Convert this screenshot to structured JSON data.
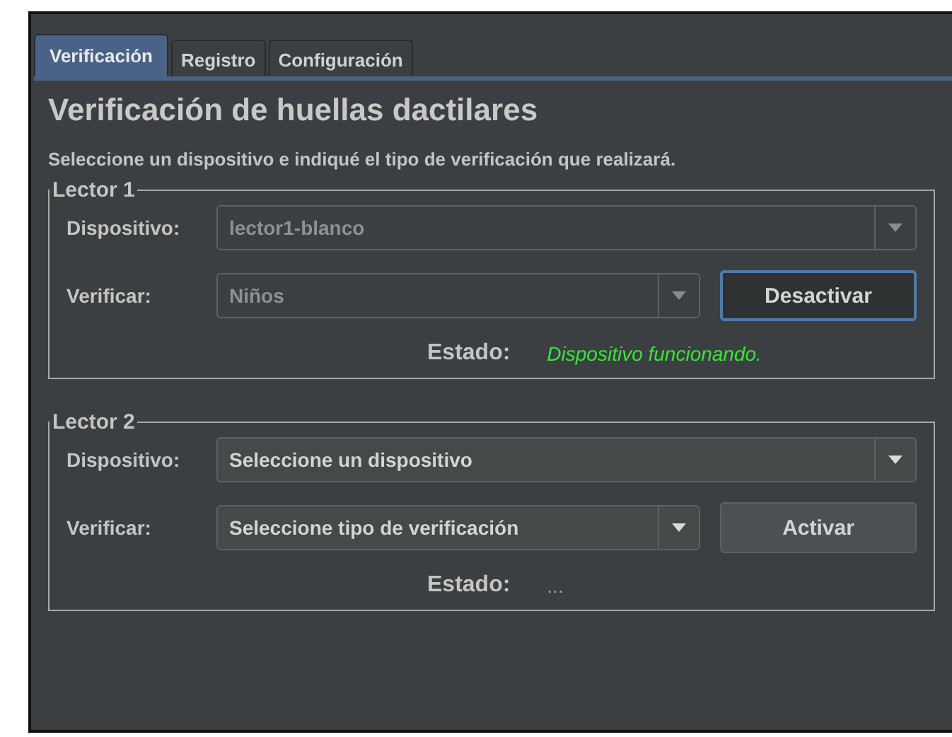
{
  "tabs": [
    {
      "label": "Verificación",
      "selected": true
    },
    {
      "label": "Registro",
      "selected": false
    },
    {
      "label": "Configuración",
      "selected": false
    }
  ],
  "heading": "Verificación de huellas dactilares",
  "instructions": "Seleccione un dispositivo e indiqué el tipo de verificación que realizará.",
  "readers": [
    {
      "title": "Lector 1",
      "device_label": "Dispositivo:",
      "device_value": "lector1-blanco",
      "device_disabled": true,
      "verify_label": "Verificar:",
      "verify_value": "Niños",
      "verify_disabled": true,
      "button": {
        "label": "Desactivar",
        "focused": true
      },
      "status_label": "Estado:",
      "status": {
        "text": "Dispositivo funcionando.",
        "kind": "ok"
      }
    },
    {
      "title": "Lector 2",
      "device_label": "Dispositivo:",
      "device_value": "Seleccione un dispositivo",
      "device_disabled": false,
      "verify_label": "Verificar:",
      "verify_value": "Seleccione tipo de verificación",
      "verify_disabled": false,
      "button": {
        "label": "Activar",
        "focused": false
      },
      "status_label": "Estado:",
      "status": {
        "text": "...",
        "kind": "idle"
      }
    }
  ]
}
